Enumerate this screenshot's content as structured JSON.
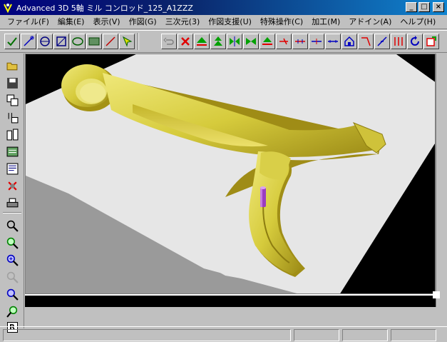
{
  "window": {
    "title": "Advanced 3D 5軸 ミル  コンロッド_125_A1ZZZ",
    "controls": {
      "minimize": "_",
      "maximize": "□",
      "close": "×"
    }
  },
  "menubar": {
    "items": [
      {
        "label": "ファイル(F)"
      },
      {
        "label": "編集(E)"
      },
      {
        "label": "表示(V)"
      },
      {
        "label": "作図(G)"
      },
      {
        "label": "三次元(3)"
      },
      {
        "label": "作図支援(U)"
      },
      {
        "label": "特殊操作(C)"
      },
      {
        "label": "加工(M)"
      },
      {
        "label": "アドイン(A)"
      },
      {
        "label": "ヘルプ(H)"
      }
    ]
  },
  "toolbar": {
    "icons": [
      "check-line-icon",
      "arc-icon",
      "circle-line-icon",
      "square-diag-icon",
      "ellipse-icon",
      "rectangle-icon",
      "diagonal-line-icon",
      "arrow-cursor-icon",
      "undo-icon",
      "delete-x-icon",
      "triangle-up-icon",
      "double-triangle-icon",
      "mirror-icon",
      "bowtie-icon",
      "fold-up-icon",
      "cross-arrow-icon",
      "dimension-horizontal-icon",
      "dimension-vertical-icon",
      "dimension-line-icon",
      "house-icon",
      "corner-icon",
      "slash-icon",
      "split-icon",
      "rotate-icon",
      "exit-icon"
    ]
  },
  "left_toolbar": {
    "icons": [
      "open-folder-icon",
      "save-disk-icon",
      "copy-window-icon",
      "paint-icon",
      "compare-icon",
      "layers-icon",
      "text-edit-icon",
      "no-stamp-icon",
      "print-icon",
      "zoom-icon",
      "zoom-fit-icon",
      "zoom-in-icon",
      "zoom-out-icon",
      "zoom-window-icon",
      "zoom-previous-icon",
      "redraw-icon"
    ],
    "redraw_label": "R"
  },
  "status": {
    "panes": [
      "",
      "",
      "",
      ""
    ]
  },
  "colors": {
    "titlebar": "#000080",
    "part_yellow": "#d7cd3e",
    "part_shadow": "#8c7c10",
    "table_top": "#e6e6e6",
    "table_side": "#9a9a9a",
    "tool": "#9b3cc0",
    "background": "#000000"
  }
}
